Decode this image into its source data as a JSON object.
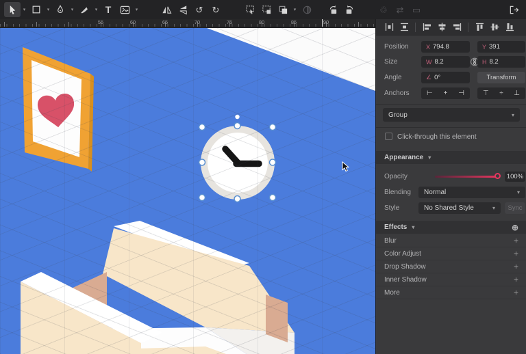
{
  "ruler": {
    "numbers": [
      "55",
      "60",
      "65",
      "70",
      "75",
      "80",
      "85",
      "90"
    ]
  },
  "icons": {
    "chevron_down": "▾",
    "rotate_ccw": "↺",
    "rotate_cw": "↻",
    "recycle": "♲",
    "swap": "⇄",
    "rect_faded": "▭",
    "text_tool": "T",
    "anchor_left": "⊢",
    "anchor_center": "+",
    "anchor_right": "⊣",
    "anchor_top": "⊤",
    "anchor_middle": "÷",
    "anchor_bottom": "⊥",
    "plus": "+",
    "plus_circle": "⊕"
  },
  "panel": {
    "position": {
      "label": "Position",
      "x_prefix": "X",
      "x_value": "794.8",
      "y_prefix": "Y",
      "y_value": "391"
    },
    "size": {
      "label": "Size",
      "w_prefix": "W",
      "w_value": "8.2",
      "h_prefix": "H",
      "h_value": "8.2"
    },
    "angle": {
      "label": "Angle",
      "prefix": "∠",
      "value": "0°",
      "transform_label": "Transform"
    },
    "anchors": {
      "label": "Anchors"
    },
    "group": {
      "value": "Group"
    },
    "click_through": {
      "label": "Click-through this element"
    },
    "appearance": {
      "title": "Appearance",
      "opacity": {
        "label": "Opacity",
        "value": "100%"
      },
      "blending": {
        "label": "Blending",
        "value": "Normal"
      },
      "style": {
        "label": "Style",
        "value": "No Shared Style",
        "sync_label": "Sync"
      }
    },
    "effects": {
      "title": "Effects",
      "rows": [
        {
          "label": "Blur"
        },
        {
          "label": "Color Adjust"
        },
        {
          "label": "Drop Shadow"
        },
        {
          "label": "Inner Shadow"
        },
        {
          "label": "More"
        }
      ]
    }
  },
  "colors": {
    "accent_pink": "#e8365f",
    "canvas_blue": "#4b7cdc",
    "frame_orange": "#f0a233",
    "heart_pink": "#d85168",
    "chair_cream": "#f8e6c9",
    "chair_rose": "#d9ab92",
    "selection_blue": "#5a8fd0"
  }
}
